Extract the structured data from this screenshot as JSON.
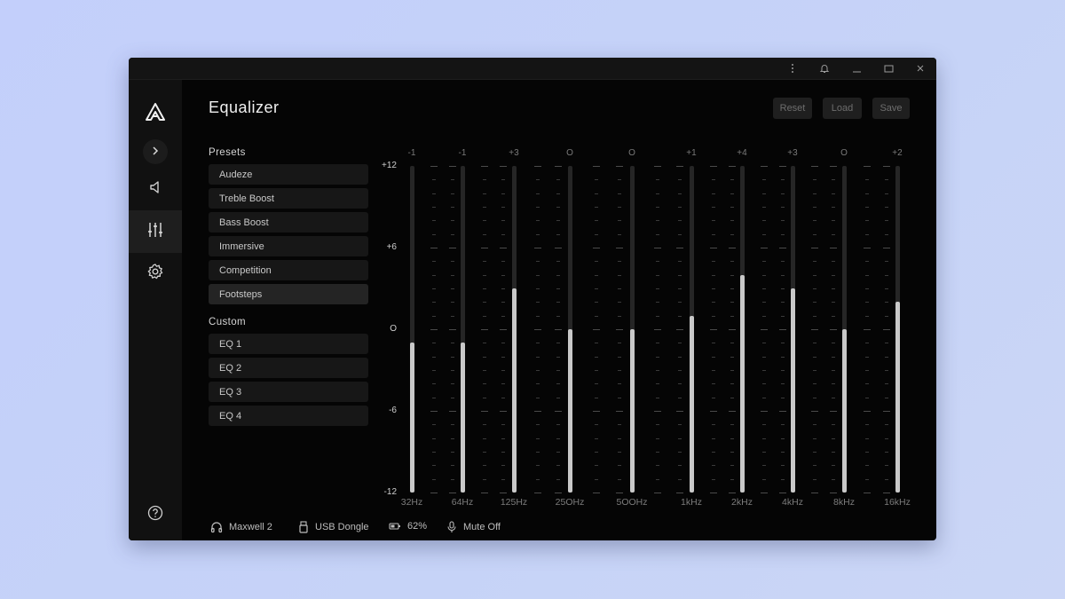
{
  "window": {
    "titlebar_icons": [
      "more-vertical-icon",
      "bell-icon",
      "minimize-icon",
      "maximize-icon",
      "close-icon"
    ]
  },
  "sidebar": {
    "items": [
      {
        "name": "logo",
        "icon": "app-logo-icon"
      },
      {
        "name": "expand",
        "icon": "chevron-right-icon"
      },
      {
        "name": "sound",
        "icon": "speaker-icon"
      },
      {
        "name": "equalizer",
        "icon": "sliders-icon",
        "active": true
      },
      {
        "name": "settings",
        "icon": "gear-icon"
      },
      {
        "name": "help",
        "icon": "question-icon"
      }
    ]
  },
  "header": {
    "title": "Equalizer",
    "reset_label": "Reset",
    "load_label": "Load",
    "save_label": "Save"
  },
  "presets": {
    "label": "Presets",
    "items": [
      "Audeze",
      "Treble Boost",
      "Bass Boost",
      "Immersive",
      "Competition",
      "Footsteps"
    ],
    "selected": "Footsteps"
  },
  "custom": {
    "label": "Custom",
    "items": [
      "EQ 1",
      "EQ 2",
      "EQ 3",
      "EQ 4"
    ]
  },
  "eq": {
    "y_labels": [
      "+12",
      "+6",
      "O",
      "-6",
      "-12"
    ],
    "range": [
      -12,
      12
    ],
    "bands": [
      {
        "freq": "32Hz",
        "label": "-1",
        "gain": -1
      },
      {
        "freq": "64Hz",
        "label": "-1",
        "gain": -1
      },
      {
        "freq": "125Hz",
        "label": "+3",
        "gain": 3
      },
      {
        "freq": "25OHz",
        "label": "O",
        "gain": 0
      },
      {
        "freq": "5OOHz",
        "label": "O",
        "gain": 0
      },
      {
        "freq": "1kHz",
        "label": "+1",
        "gain": 1
      },
      {
        "freq": "2kHz",
        "label": "+4",
        "gain": 4
      },
      {
        "freq": "4kHz",
        "label": "+3",
        "gain": 3
      },
      {
        "freq": "8kHz",
        "label": "O",
        "gain": 0
      },
      {
        "freq": "16kHz",
        "label": "+2",
        "gain": 2
      }
    ]
  },
  "status": {
    "headset": "Maxwell 2",
    "connection": "USB Dongle",
    "battery": "62%",
    "mic": "Mute Off"
  },
  "colors": {
    "background": "#050505",
    "fill": "#c9c9c9",
    "track": "#262626"
  }
}
